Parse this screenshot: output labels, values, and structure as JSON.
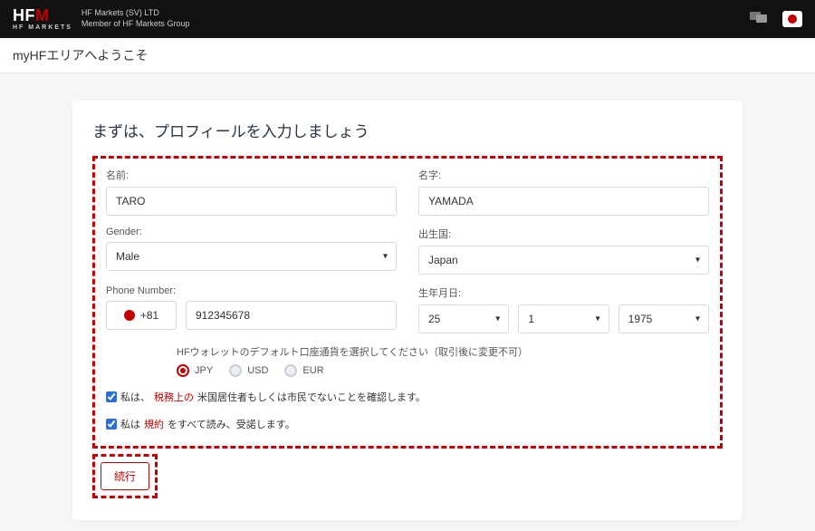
{
  "header": {
    "logo_main": "HF",
    "logo_m": "M",
    "logo_sub": "HF MARKETS",
    "line1": "HF Markets (SV) LTD",
    "line2": "Member of HF Markets Group"
  },
  "welcome": "myHFエリアへようこそ",
  "card": {
    "title": "まずは、プロフィールを入力しましょう"
  },
  "form": {
    "first_name_label": "名前:",
    "first_name_value": "TARO",
    "last_name_label": "名字:",
    "last_name_value": "YAMADA",
    "gender_label": "Gender:",
    "gender_value": "Male",
    "country_label": "出生国:",
    "country_value": "Japan",
    "phone_label": "Phone Number:",
    "dial_code": "+81",
    "phone_value": "912345678",
    "dob_label": "生年月日:",
    "dob_day": "25",
    "dob_month": "1",
    "dob_year": "1975",
    "wallet_label": "HFウォレットのデフォルト口座通貨を選択してください（取引後に変更不可）",
    "wallet_options": [
      "JPY",
      "USD",
      "EUR"
    ],
    "wallet_selected": "JPY",
    "consent1_pre": "私は、",
    "consent1_red": "税務上の",
    "consent1_post": "米国居住者もしくは市民でないことを確認します。",
    "consent2_pre": "私は ",
    "consent2_red": "規約",
    "consent2_post": "をすべて読み、受諾します。",
    "continue": "続行"
  }
}
